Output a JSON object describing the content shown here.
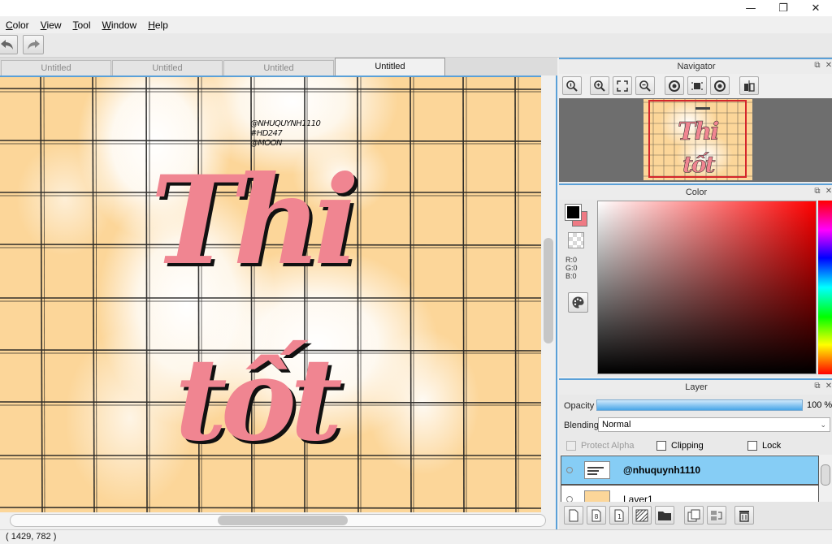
{
  "window": {
    "minimize_glyph": "—",
    "restore_glyph": "❐",
    "close_glyph": "✕"
  },
  "menubar": {
    "items": [
      {
        "label": "Color",
        "accel": "C",
        "rest": "olor"
      },
      {
        "label": "View",
        "accel": "V",
        "rest": "iew"
      },
      {
        "label": "Tool",
        "accel": "T",
        "rest": "ool"
      },
      {
        "label": "Window",
        "accel": "W",
        "rest": "indow"
      },
      {
        "label": "Help",
        "accel": "H",
        "rest": "elp"
      }
    ]
  },
  "toolbar": {
    "undo_icon": "undo-icon",
    "redo_icon": "redo-icon"
  },
  "tabs": [
    {
      "label": "Untitled",
      "active": false
    },
    {
      "label": "Untitled",
      "active": false
    },
    {
      "label": "Untitled",
      "active": false
    },
    {
      "label": "Untitled",
      "active": true
    }
  ],
  "artwork": {
    "credit_lines": [
      "@NHUQUYNH1110",
      "#HD247",
      "@MOON"
    ],
    "title_line1": "Thi",
    "title_line2": "tốt",
    "text_color": "#f08591",
    "background_color": "#fcd699"
  },
  "navigator": {
    "title": "Navigator",
    "tools": [
      "zoom-actual-icon",
      "zoom-in-icon",
      "fit-icon",
      "zoom-out-icon",
      "rotate-left-icon",
      "rotate-reset-icon",
      "rotate-right-icon",
      "flip-icon"
    ]
  },
  "color": {
    "title": "Color",
    "foreground": "#000000",
    "background": "#ef7a84",
    "r_label": "R:0",
    "g_label": "G:0",
    "b_label": "B:0"
  },
  "layer": {
    "title": "Layer",
    "opacity_label": "Opacity",
    "opacity_value": "100 %",
    "opacity_fraction": 1.0,
    "blending_label": "Blending",
    "blending_value": "Normal",
    "protect_alpha_label": "Protect Alpha",
    "clipping_label": "Clipping",
    "lock_label": "Lock",
    "layers": [
      {
        "name": "@nhuquynh1110",
        "selected": true
      },
      {
        "name": "Layer1",
        "selected": false
      }
    ]
  },
  "status": {
    "coords": "( 1429, 782 )"
  }
}
